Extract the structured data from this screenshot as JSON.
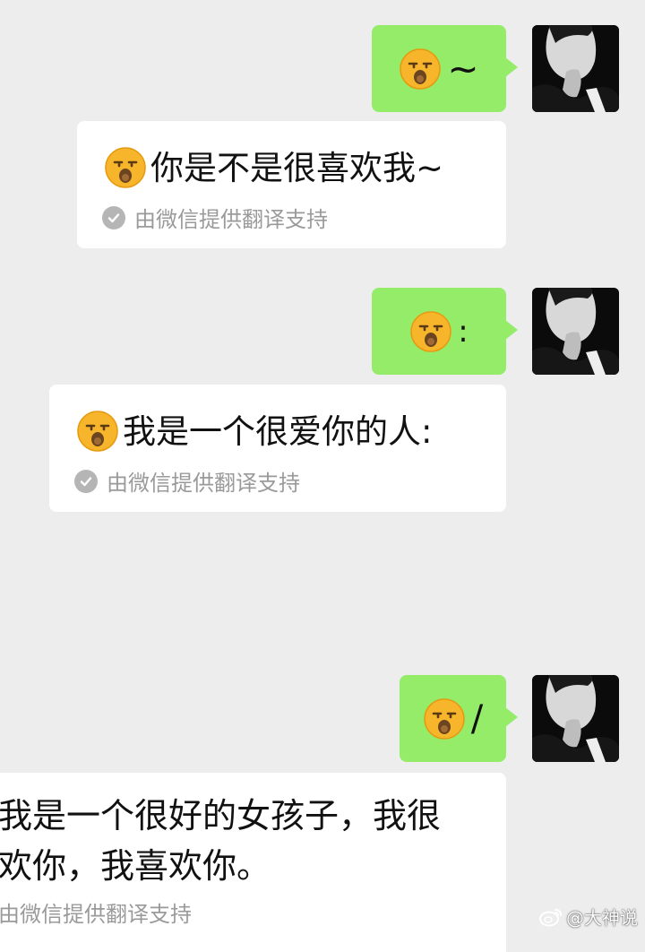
{
  "messages": [
    {
      "sent_symbol": "~",
      "translation": "你是不是很喜欢我~",
      "credit": "由微信提供翻译支持"
    },
    {
      "sent_symbol": ":",
      "translation": "我是一个很爱你的人:",
      "credit": "由微信提供翻译支持"
    },
    {
      "sent_symbol": "/",
      "translation_line1": "我是一个很好的女孩子，我很",
      "translation_line2": "欢你，我喜欢你。",
      "credit": "由微信提供翻译支持"
    }
  ],
  "watermark": "@大神说",
  "colors": {
    "background": "#ededed",
    "sent_bubble": "#95ec69",
    "card": "#ffffff",
    "credit_text": "#9a9a9a"
  },
  "icons": [
    "sleepy-emoji-icon",
    "check-circle-icon",
    "avatar",
    "weibo-icon"
  ]
}
